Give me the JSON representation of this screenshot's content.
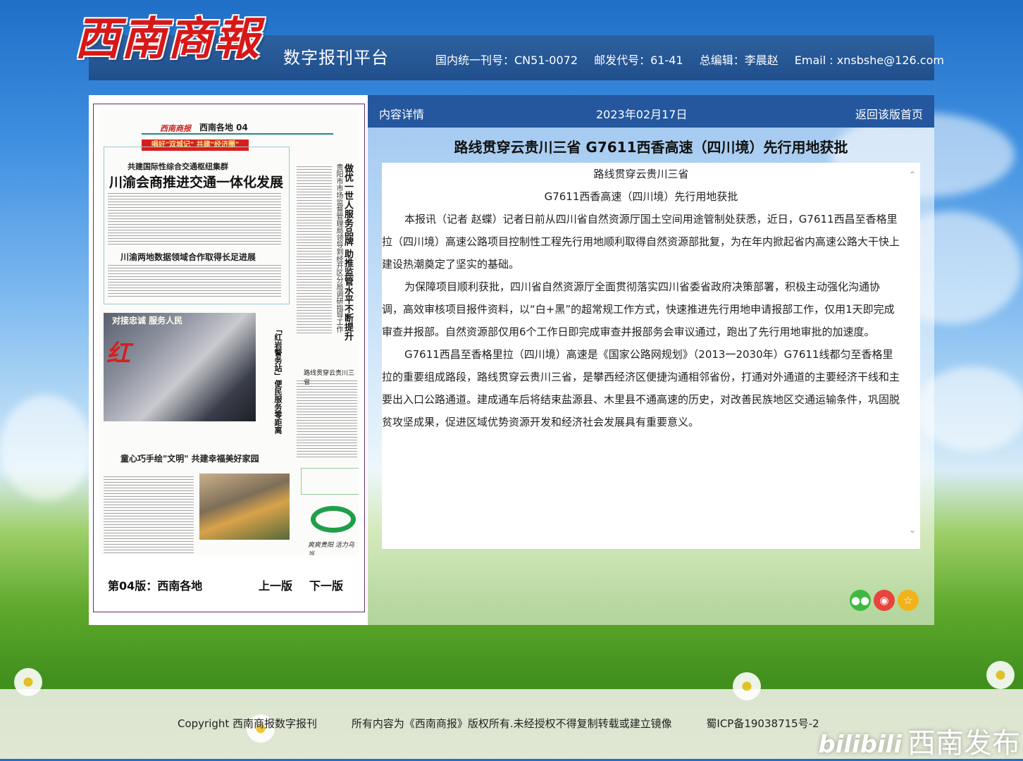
{
  "header": {
    "logo": "西南商報",
    "platform_name": "数字报刊平台",
    "issn": "国内统一刊号：CN51-0072",
    "postal_code": "邮发代号：61-41",
    "editor": "总编辑：李晨赵",
    "email": "Email : xnsbshe@126.com"
  },
  "paper": {
    "masthead": "西南商报",
    "section": "西南各地 04",
    "banner": "唱好\"双城记\" 共建\"经济圈\"",
    "headline1_sub": "共建国际性综合交通枢纽集群",
    "headline1": "川渝会商推进交通一体化发展",
    "headline2": "川渝两地数据领域合作取得长足进展",
    "vertical_headline": "做优一世人服务品牌 助推监管水平不断提升",
    "vertical_sub": "贵阳市市场监督管理局领导到经开区分局调研指导工作",
    "photo_caption": "对接忠诚 服务人民",
    "photo_side": "「红岩警务站」便民服务零距离",
    "small_title": "路线贯穿云贵川三省",
    "headline3": "童心巧手绘\"文明\" 共建幸福美好家园",
    "slogan": "爽爽贵阳 活力乌当",
    "edition": "第04版：西南各地",
    "prev": "上一版",
    "next": "下一版"
  },
  "detail_bar": {
    "label": "内容详情",
    "date": "2023年02月17日",
    "back": "返回该版首页"
  },
  "article": {
    "title": "路线贯穿云贵川三省 G7611西香高速（四川境）先行用地获批",
    "sub1": "路线贯穿云贵川三省",
    "sub2": "G7611西香高速（四川境）先行用地获批",
    "p1": "本报讯（记者  赵蝶）记者日前从四川省自然资源厅国土空间用途管制处获悉，近日，G7611西昌至香格里拉（四川境）高速公路项目控制性工程先行用地顺利取得自然资源部批复，为在年内掀起省内高速公路大干快上建设热潮奠定了坚实的基础。",
    "p2": "为保障项目顺利获批，四川省自然资源厅全面贯彻落实四川省委省政府决策部署，积极主动强化沟通协调，高效审核项目报件资料，以“白+黑”的超常规工作方式，快速推进先行用地申请报部工作，仅用1天即完成审查并报部。自然资源部仅用6个工作日即完成审查并报部务会审议通过，跑出了先行用地审批的加速度。",
    "p3": "G7611西昌至香格里拉（四川境）高速是《国家公路网规划》（2013一2030年）G7611线都匀至香格里拉的重要组成路段，路线贯穿云贵川三省，是攀西经济区便捷沟通相邻省份，打通对外通道的主要经济干线和主要出入口公路通道。建成通车后将结束盐源县、木里县不通高速的历史，对改善民族地区交通运输条件，巩固脱贫攻坚成果，促进区域优势资源开发和经济社会发展具有重要意义。"
  },
  "share": {
    "wechat_icon": "wechat-icon",
    "weibo_icon": "weibo-icon",
    "favorite_icon": "star-icon"
  },
  "footer": {
    "copyright": "Copyright 西南商报数字报刊",
    "rights": "所有内容为《西南商报》版权所有.未经授权不得复制转载或建立镜像",
    "icp": "蜀ICP备19038715号-2"
  },
  "watermark": {
    "brand": "bilibili",
    "channel": "西南发布"
  }
}
